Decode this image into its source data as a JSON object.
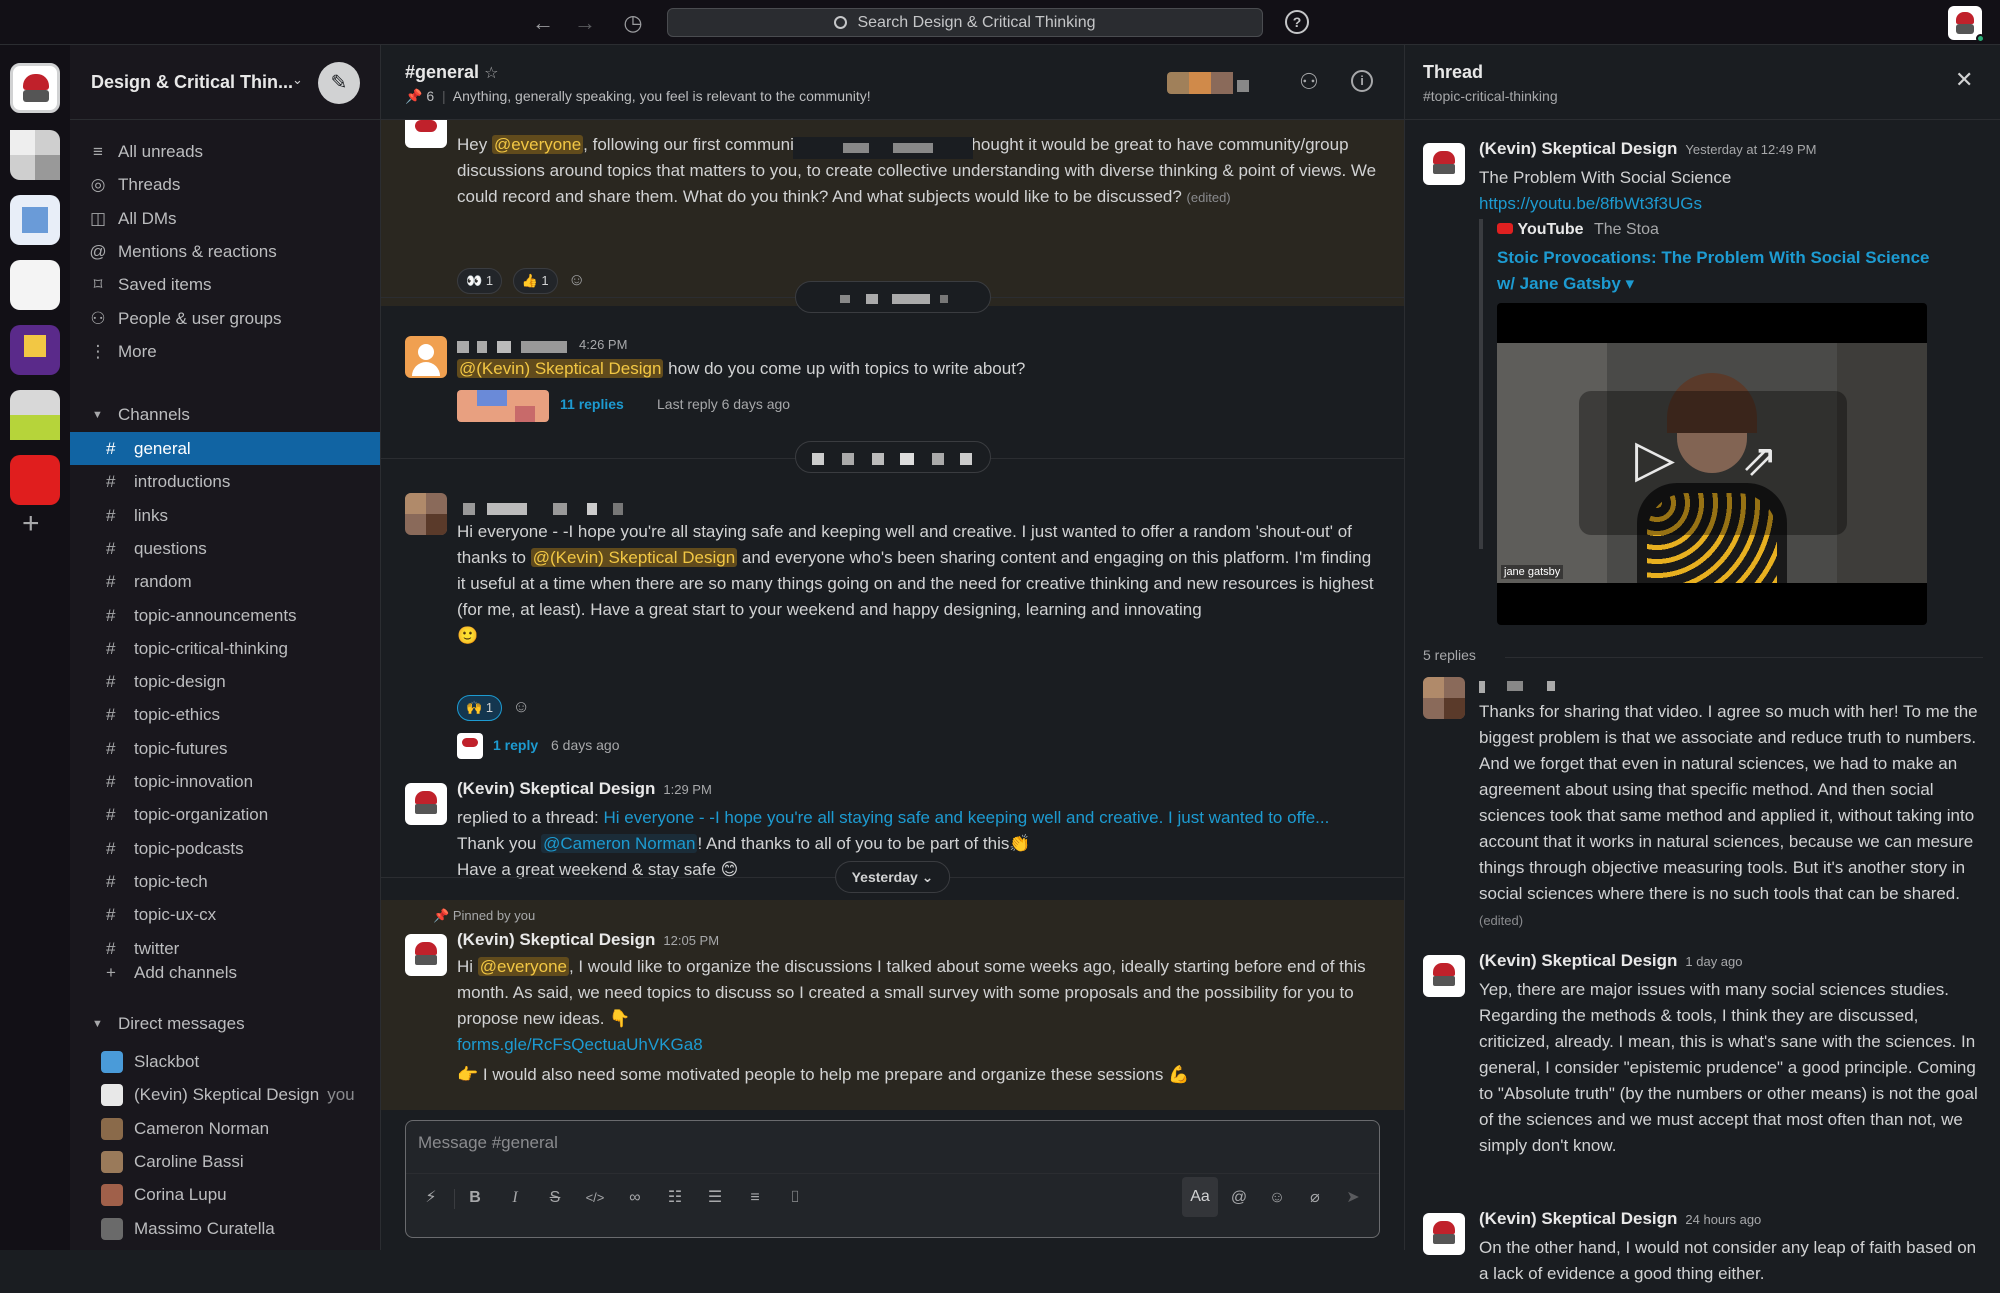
{
  "topbar": {
    "search_placeholder": "Search Design & Critical Thinking",
    "back_icon": "←",
    "forward_icon": "→",
    "history_icon": "◷",
    "help_icon": "?"
  },
  "workspace": {
    "name": "Design & Critical Thin...",
    "caret": "⌄"
  },
  "nav": [
    {
      "icon": "≡",
      "label": "All unreads"
    },
    {
      "icon": "◎",
      "label": "Threads"
    },
    {
      "icon": "◫",
      "label": "All DMs"
    },
    {
      "icon": "@",
      "label": "Mentions & reactions"
    },
    {
      "icon": "⌑",
      "label": "Saved items"
    },
    {
      "icon": "⚇",
      "label": "People & user groups"
    },
    {
      "icon": "⋮",
      "label": "More"
    }
  ],
  "channels_section": "Channels",
  "channels": [
    "general",
    "introductions",
    "links",
    "questions",
    "random",
    "topic-announcements",
    "topic-critical-thinking",
    "topic-design",
    "topic-ethics",
    "topic-futures",
    "topic-innovation",
    "topic-organization",
    "topic-podcasts",
    "topic-tech",
    "topic-ux-cx",
    "twitter"
  ],
  "add_channels": "Add channels",
  "dm_section": "Direct messages",
  "dms": [
    {
      "name": "Slackbot",
      "you": "",
      "color": "#4a9bd9"
    },
    {
      "name": "(Kevin) Skeptical Design",
      "you": "you",
      "color": "#e8e8e8"
    },
    {
      "name": "Cameron Norman",
      "you": "",
      "color": "#8a6a4a"
    },
    {
      "name": "Caroline Bassi",
      "you": "",
      "color": "#9a7a5a"
    },
    {
      "name": "Corina Lupu",
      "you": "",
      "color": "#a0604a"
    },
    {
      "name": "Massimo Curatella",
      "you": "",
      "color": "#6a6a6a"
    }
  ],
  "channel": {
    "title": "#general",
    "pins": "6",
    "topic": "Anything, generally speaking, you feel is relevant to the community!"
  },
  "messages": {
    "m1": {
      "hey": "Hey",
      "mention": "@everyone",
      "text": ", following our first community meeting last week, I thought it would be great to have community/group discussions around topics that matters to you, to create collective understanding with diverse thinking & point of views. We could record and share them. What do you think? And what subjects would like to be discussed?",
      "edited": "(edited)",
      "reactions": [
        {
          "emoji": "👀",
          "count": "1"
        },
        {
          "emoji": "👍",
          "count": "1"
        }
      ]
    },
    "m2": {
      "time": "4:26 PM",
      "mention": "@(Kevin) Skeptical Design",
      "text": " how do you come up with topics to write about?",
      "replies": "11 replies",
      "last_reply": "Last reply 6 days ago"
    },
    "m3": {
      "text1": "Hi everyone - -I hope you're all staying safe and keeping well and creative. I just wanted to offer a random 'shout-out' of thanks to ",
      "mention": "@(Kevin) Skeptical Design",
      "text2": " and everyone who's been sharing content and engaging on this platform. I'm finding it useful at a time when there are so many things going on and the need for creative thinking and new resources is highest (for me, at least). Have a great start to your weekend and happy designing, learning and innovating",
      "emoji": "🙂",
      "reaction": {
        "emoji": "🙌",
        "count": "1"
      },
      "reply": "1 reply",
      "reply_time": "6 days ago"
    },
    "m4": {
      "author": "(Kevin) Skeptical Design",
      "time": "1:29 PM",
      "replied_prefix": "replied to a thread: ",
      "replied_link": "Hi everyone - -I hope you're all staying safe and keeping well and creative. I just wanted to offe...",
      "thank": "Thank you ",
      "mention": "@Cameron Norman",
      "thank2": "! And thanks to all of you to be part of this👏",
      "line2": "Have a great weekend & stay safe 😊"
    },
    "divider_label": "Yesterday ⌄",
    "m5": {
      "pinned": "Pinned by you",
      "author": "(Kevin) Skeptical Design",
      "time": "12:05 PM",
      "hi": "Hi ",
      "mention": "@everyone",
      "text": ", I would like to organize the discussions I talked about some weeks ago, ideally starting before end of this month. As said, we need topics to discuss so I created a small survey with some proposals and the possibility for you to propose new ideas. 👇",
      "link": "forms.gle/RcFsQectuaUhVKGa8",
      "line2": "👉 I would also need some motivated people to help me prepare and organize these sessions 💪"
    }
  },
  "composer": {
    "placeholder": "Message #general",
    "aa": "Aa"
  },
  "thread": {
    "title": "Thread",
    "channel": "#topic-critical-thinking",
    "op": {
      "author": "(Kevin) Skeptical Design",
      "time": "Yesterday at 12:49 PM",
      "title": "The Problem With Social Science",
      "url": "https://youtu.be/8fbWt3f3UGs",
      "source": "YouTube",
      "channel": "The Stoa",
      "video_title": "Stoic Provocations: The Problem With Social Science w/ Jane Gatsby ▾",
      "caption": "jane gatsby"
    },
    "replies_count": "5 replies",
    "r1": {
      "text": "Thanks for sharing that video. I agree so much with her! To me the biggest problem is that we associate and reduce truth to numbers. And we forget that even in natural sciences, we had to make an agreement about using that specific method. And then social sciences took that same method and applied it, without taking into account that it works in natural sciences, because we can mesure things through objective measuring tools. But it's another story in social sciences where there is no such tools that can be shared.",
      "edited": "(edited)"
    },
    "r2": {
      "author": "(Kevin) Skeptical Design",
      "time": "1 day ago",
      "text": "Yep, there are major issues with many social sciences studies. Regarding the methods & tools, I think they are discussed, criticized, already. I mean, this is what's sane with the sciences. In general, I consider \"epistemic prudence\" a good principle. Coming to \"Absolute truth\" (by the numbers or other means) is not the goal of the sciences and we must accept that most often than not, we simply don't know."
    },
    "r3": {
      "author": "(Kevin) Skeptical Design",
      "time": "24 hours ago",
      "text": "On the other hand, I would not consider any leap of faith based on a lack of evidence a good thing either."
    }
  }
}
